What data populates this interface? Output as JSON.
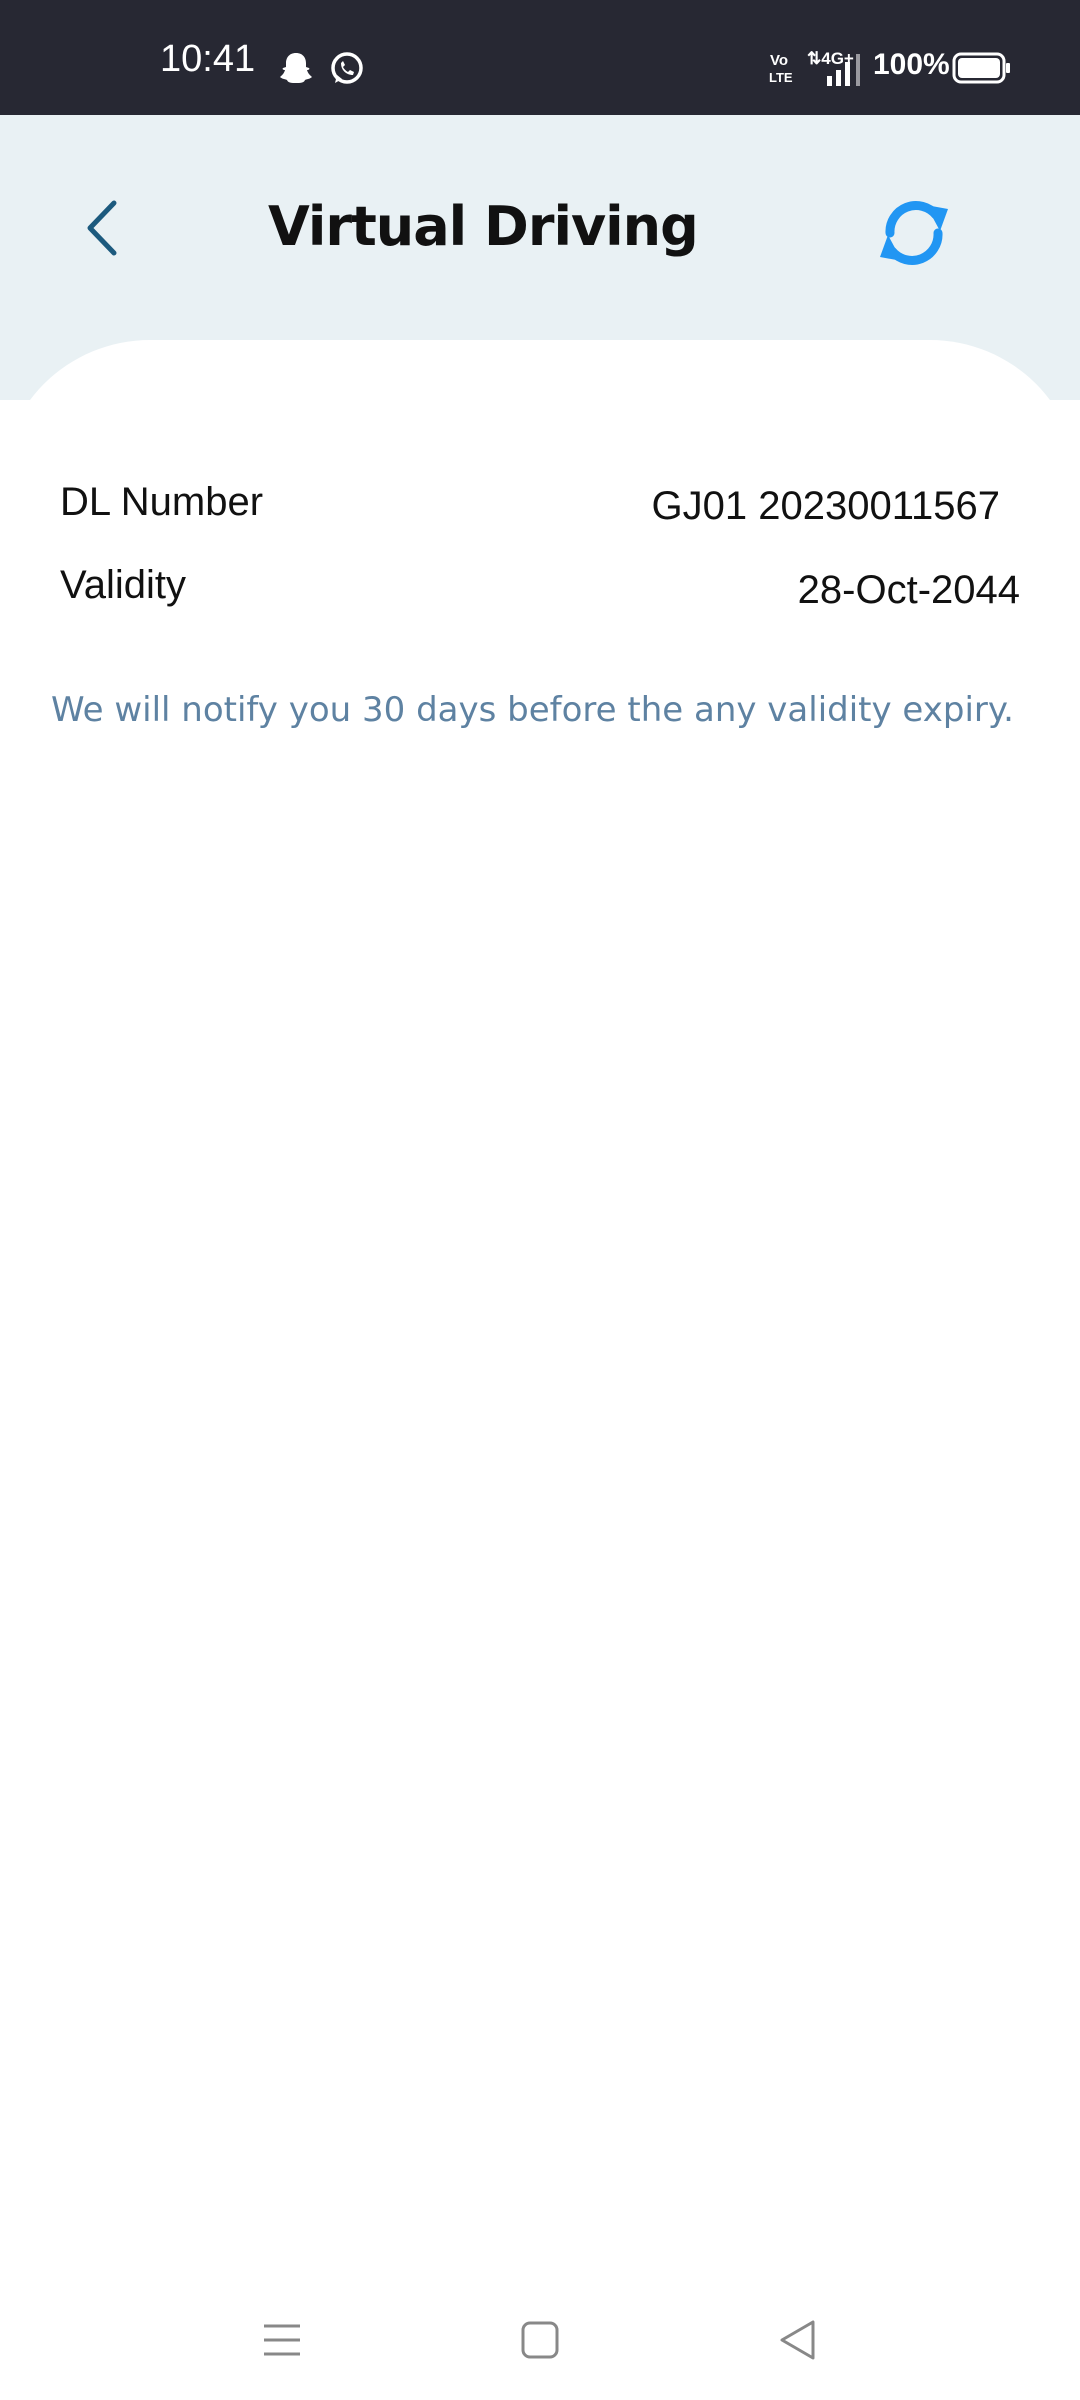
{
  "status_bar": {
    "time": "10:41",
    "battery_percent": "100%",
    "network": "4G",
    "volte": "Vo LTE",
    "notification_icons": [
      "snapchat-icon",
      "whatsapp-icon"
    ]
  },
  "header": {
    "title": "Virtual Driving",
    "back_icon": "chevron-left-icon",
    "refresh_icon": "refresh-icon"
  },
  "details": {
    "dl_number_label": "DL Number",
    "dl_number_value": "GJ01 20230011567",
    "validity_label": "Validity",
    "validity_value": "28-Oct-2044"
  },
  "notice": "We will notify you 30 days before the any validity expiry.",
  "nav_bar": {
    "items": [
      "menu-icon",
      "home-icon",
      "back-triangle-icon"
    ]
  },
  "colors": {
    "status_bar_bg": "#272833",
    "header_bg": "#e9f1f4",
    "accent": "#2196f3",
    "back_icon": "#1c5a7e",
    "notice_text": "#5e82a2"
  }
}
